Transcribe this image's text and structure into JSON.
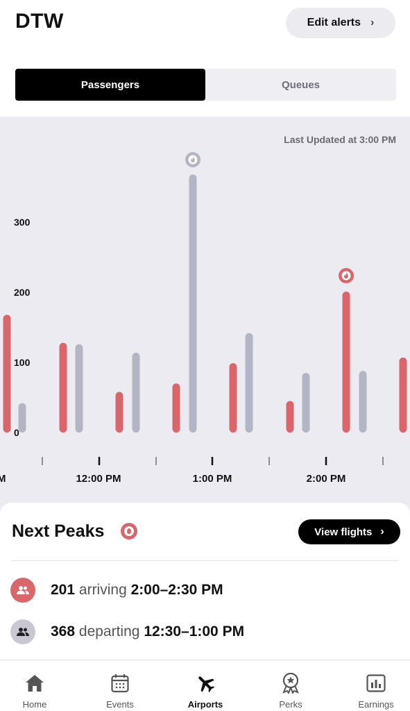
{
  "header": {
    "title": "DTW",
    "edit_alerts_label": "Edit alerts"
  },
  "segmented": {
    "tabs": [
      "Passengers",
      "Queues"
    ],
    "active": "Passengers"
  },
  "chart": {
    "last_updated": "Last Updated at 3:00 PM"
  },
  "chart_data": {
    "type": "bar",
    "y_ticks": [
      "0",
      "100",
      "200",
      "300"
    ],
    "ylim": [
      0,
      380
    ],
    "x_tick_labels": [
      "M",
      "12:00 PM",
      "1:00 PM",
      "2:00 PM"
    ],
    "series": [
      {
        "color": "#d9666b",
        "values": [
          168,
          128,
          58,
          70,
          99,
          45,
          201,
          107
        ]
      },
      {
        "color": "#b4b5c4",
        "values": [
          42,
          126,
          114,
          368,
          142,
          85,
          88
        ]
      }
    ],
    "peak_markers": [
      "departing 368",
      "arriving 201"
    ]
  },
  "next_peaks": {
    "title": "Next Peaks",
    "view_flights_label": "View flights",
    "rows": [
      {
        "count": "201",
        "direction": "arriving",
        "window": "2:00–2:30 PM"
      },
      {
        "count": "368",
        "direction": "departing",
        "window": "12:30–1:00 PM"
      }
    ]
  },
  "tabbar": {
    "items": [
      "Home",
      "Events",
      "Airports",
      "Perks",
      "Earnings"
    ],
    "active": "Airports"
  },
  "colors": {
    "arriving": "#d9666b",
    "departing": "#b4b5c4",
    "chart_bg": "#ecebf1"
  }
}
